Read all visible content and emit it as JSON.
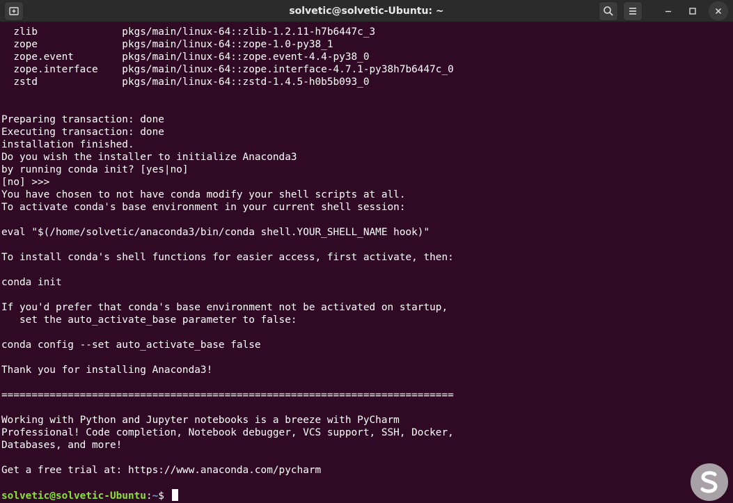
{
  "window": {
    "title": "solvetic@solvetic-Ubuntu: ~",
    "icons": {
      "new_tab": "new-tab-icon",
      "search": "search-icon",
      "menu": "hamburger-menu-icon",
      "minimize": "minimize-icon",
      "maximize": "maximize-icon",
      "close": "close-icon"
    }
  },
  "colors": {
    "terminal_bg": "#300a24",
    "titlebar_bg": "#2b2b2b",
    "text": "#ffffff",
    "prompt_user": "#8ae234",
    "prompt_path": "#729fcf",
    "watermark": "#c0c0c0"
  },
  "terminal": {
    "lines": [
      "  zlib              pkgs/main/linux-64::zlib-1.2.11-h7b6447c_3",
      "  zope              pkgs/main/linux-64::zope-1.0-py38_1",
      "  zope.event        pkgs/main/linux-64::zope.event-4.4-py38_0",
      "  zope.interface    pkgs/main/linux-64::zope.interface-4.7.1-py38h7b6447c_0",
      "  zstd              pkgs/main/linux-64::zstd-1.4.5-h0b5b093_0",
      "",
      "",
      "Preparing transaction: done",
      "Executing transaction: done",
      "installation finished.",
      "Do you wish the installer to initialize Anaconda3",
      "by running conda init? [yes|no]",
      "[no] >>>",
      "You have chosen to not have conda modify your shell scripts at all.",
      "To activate conda's base environment in your current shell session:",
      "",
      "eval \"$(/home/solvetic/anaconda3/bin/conda shell.YOUR_SHELL_NAME hook)\"",
      "",
      "To install conda's shell functions for easier access, first activate, then:",
      "",
      "conda init",
      "",
      "If you'd prefer that conda's base environment not be activated on startup,",
      "   set the auto_activate_base parameter to false:",
      "",
      "conda config --set auto_activate_base false",
      "",
      "Thank you for installing Anaconda3!",
      "",
      "===========================================================================",
      "",
      "Working with Python and Jupyter notebooks is a breeze with PyCharm",
      "Professional! Code completion, Notebook debugger, VCS support, SSH, Docker,",
      "Databases, and more!",
      "",
      "Get a free trial at: https://www.anaconda.com/pycharm",
      ""
    ],
    "prompt": {
      "user_host": "solvetic@solvetic-Ubuntu",
      "colon": ":",
      "path": "~",
      "symbol": "$ "
    }
  },
  "watermark_icon": "solvetic-logo-icon"
}
